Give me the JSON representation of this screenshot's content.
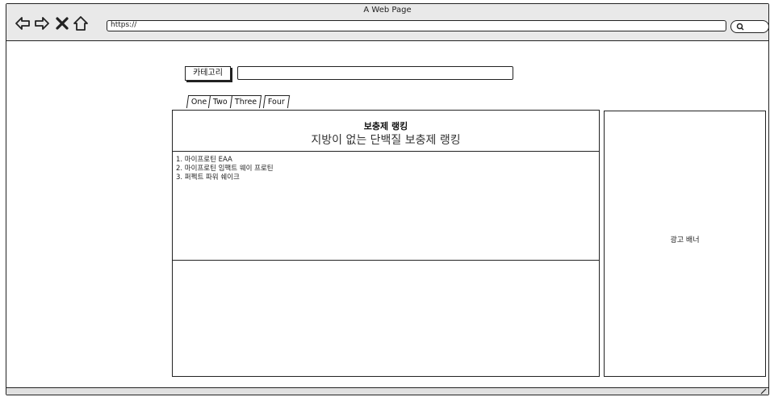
{
  "window": {
    "title": "A Web Page"
  },
  "toolbar": {
    "back_icon": "back-arrow-icon",
    "forward_icon": "forward-arrow-icon",
    "close_icon": "close-icon",
    "home_icon": "home-icon",
    "url": "https://",
    "search_icon": "search-icon"
  },
  "page": {
    "category_button_label": "카테고리",
    "category_input_value": "",
    "tabs": [
      {
        "label": "One"
      },
      {
        "label": "Two"
      },
      {
        "label": "Three"
      },
      {
        "label": "Four"
      }
    ],
    "ranking": {
      "title": "보충제 랭킹",
      "subtitle": "지방이 없는 단백질 보충제 랭킹",
      "items": [
        "1. 마이프로틴 EAA",
        "2. 마이프로틴 임팩트 웨이 프로틴",
        "3. 퍼펙트 파워 쉐이크"
      ]
    },
    "ad_banner_label": "광고 배너"
  },
  "colors": {
    "stroke": "#222222",
    "chrome_bg": "#e9e9e9",
    "page_bg": "#ffffff"
  }
}
